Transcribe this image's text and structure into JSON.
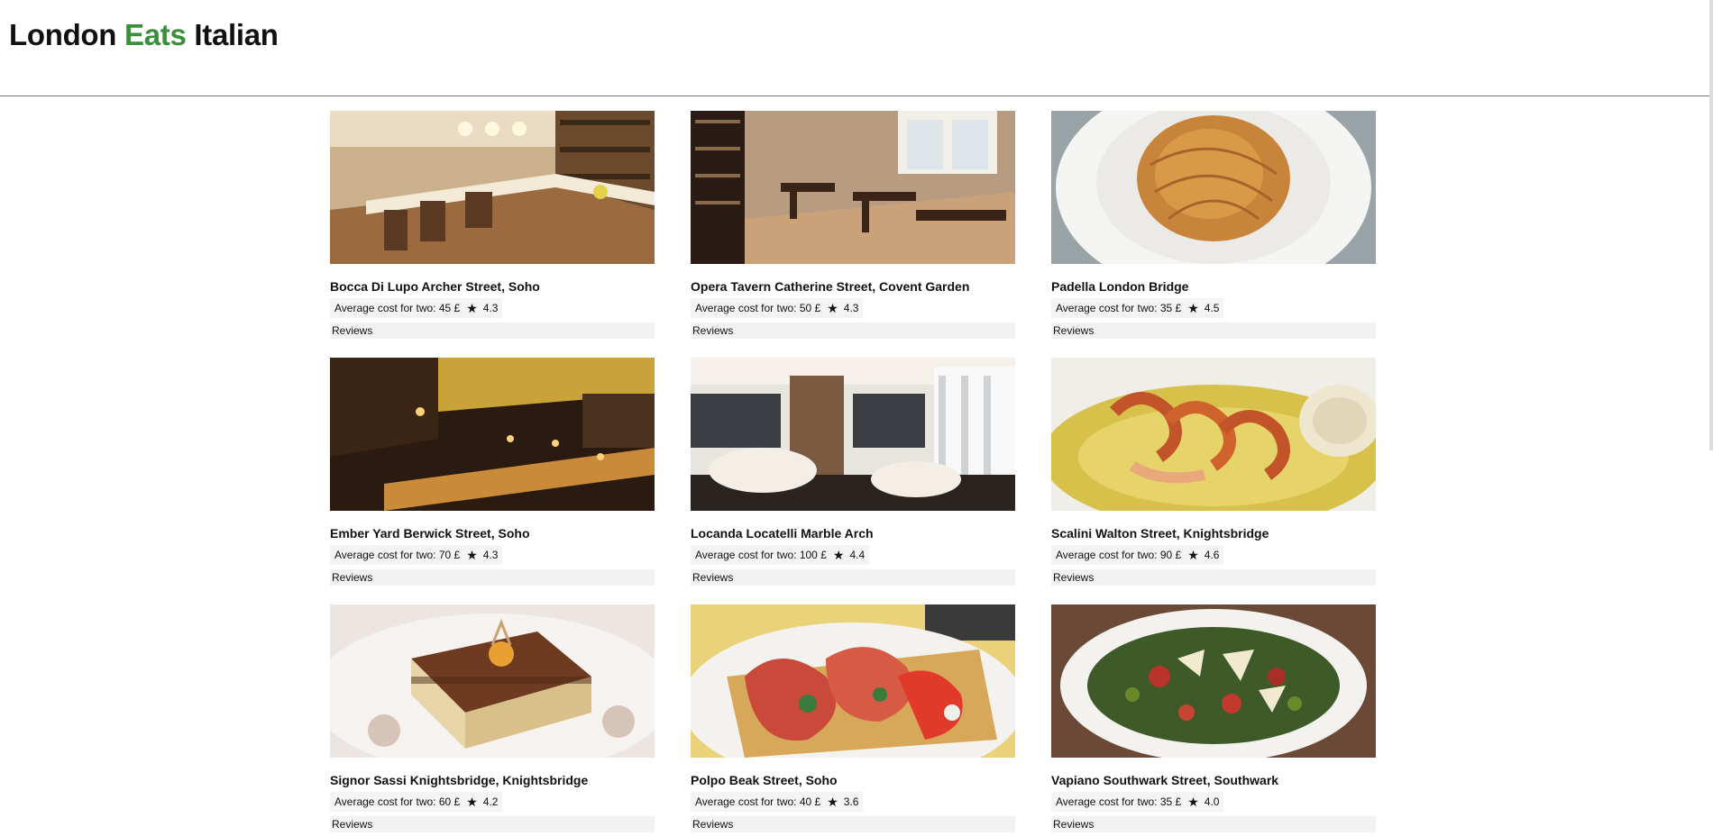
{
  "header": {
    "title_part1": "London ",
    "title_accent": "Eats",
    "title_part2": " Italian",
    "accent_color": "#3a8f3a"
  },
  "restaurants": [
    {
      "name": "Bocca Di Lupo Archer Street, Soho",
      "cost_label": "Average cost for two: 45 £",
      "rating": "4.3",
      "reviews_label": "Reviews",
      "image": "bar-interior"
    },
    {
      "name": "Opera Tavern Catherine Street, Covent Garden",
      "cost_label": "Average cost for two: 50 £",
      "rating": "4.3",
      "reviews_label": "Reviews",
      "image": "dining-room"
    },
    {
      "name": "Padella London Bridge",
      "cost_label": "Average cost for two: 35 £",
      "rating": "4.5",
      "reviews_label": "Reviews",
      "image": "pasta-plate"
    },
    {
      "name": "Ember Yard Berwick Street, Soho",
      "cost_label": "Average cost for two: 70 £",
      "rating": "4.3",
      "reviews_label": "Reviews",
      "image": "dark-bar"
    },
    {
      "name": "Locanda Locatelli Marble Arch",
      "cost_label": "Average cost for two: 100 £",
      "rating": "4.4",
      "reviews_label": "Reviews",
      "image": "white-lounge"
    },
    {
      "name": "Scalini Walton Street, Knightsbridge",
      "cost_label": "Average cost for two: 90 £",
      "rating": "4.6",
      "reviews_label": "Reviews",
      "image": "prawns-dish"
    },
    {
      "name": "Signor Sassi Knightsbridge, Knightsbridge",
      "cost_label": "Average cost for two: 60 £",
      "rating": "4.2",
      "reviews_label": "Reviews",
      "image": "tiramisu-dessert"
    },
    {
      "name": "Polpo Beak Street, Soho",
      "cost_label": "Average cost for two: 40 £",
      "rating": "3.6",
      "reviews_label": "Reviews",
      "image": "ham-toast"
    },
    {
      "name": "Vapiano Southwark Street, Southwark",
      "cost_label": "Average cost for two: 35 £",
      "rating": "4.0",
      "reviews_label": "Reviews",
      "image": "salad-bowl"
    }
  ],
  "rating_icon": "star-icon"
}
